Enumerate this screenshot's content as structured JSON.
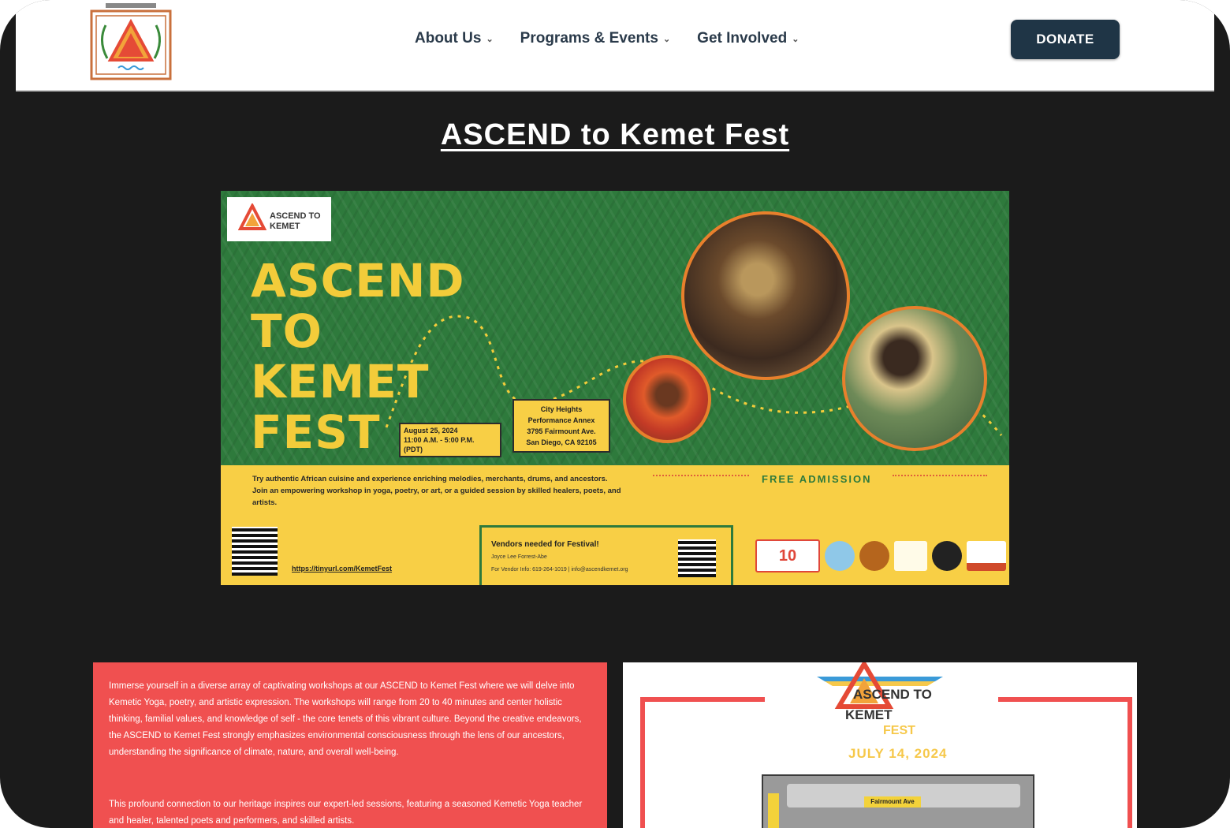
{
  "nav": {
    "items": [
      {
        "label": "About Us"
      },
      {
        "label": "Programs & Events"
      },
      {
        "label": "Get Involved"
      }
    ],
    "donate_label": "DONATE"
  },
  "page": {
    "title": "ASCEND to Kemet Fest"
  },
  "banner": {
    "logo_text": "ASCEND TO KEMET",
    "title_lines": [
      "ASCEND",
      "TO",
      "KEMET",
      "FEST"
    ],
    "date_lines": [
      "August 25, 2024",
      "11:00 A.M. - 5:00 P.M.",
      "(PDT)"
    ],
    "venue_lines": [
      "City Heights",
      "Performance Annex",
      "3795 Fairmount Ave.",
      "San Diego, CA 92105"
    ],
    "description": "Try authentic African cuisine and experience enriching melodies, merchants, drums, and ancestors. Join an empowering workshop in yoga, poetry, or art, or a guided session by skilled healers, poets, and artists.",
    "free_admission": "FREE ADMISSION",
    "link": "https://tinyurl.com/KemetFest",
    "vendor_title": "Vendors needed for Festival!",
    "vendor_line1": "Joyce Lee Forrest-Abe",
    "vendor_line2": "For Vendor Info: 619-264-1019 | info@ascendkemet.org",
    "sponsor_badge": "10"
  },
  "cards": {
    "red_paragraph_1": "Immerse yourself in a diverse array of captivating workshops at our ASCEND to Kemet Fest where we will delve into Kemetic Yoga, poetry, and artistic expression. The workshops will range from 20 to 40 minutes and center holistic thinking, familial values, and knowledge of self - the core tenets of this vibrant culture. Beyond the creative endeavors, the ASCEND to Kemet Fest strongly emphasizes environmental consciousness through the lens of our ancestors, understanding the significance of climate, nature, and overall well-being.",
    "red_paragraph_2": "This profound connection to our heritage inspires our expert-led sessions, featuring a seasoned Kemetic Yoga teacher and healer, talented poets and performers, and skilled artists.",
    "white_logo_line1": "ASCEND TO",
    "white_logo_line2": "KEMET",
    "white_fest": "FEST",
    "white_date": "JULY 14, 2024",
    "map_label": "Fairmount Ave"
  },
  "colors": {
    "donate_bg": "#1f3546",
    "banner_green": "#2e7a3c",
    "banner_yellow": "#f8cf45",
    "card_red": "#f05050",
    "page_bg": "#1b1b1b"
  }
}
